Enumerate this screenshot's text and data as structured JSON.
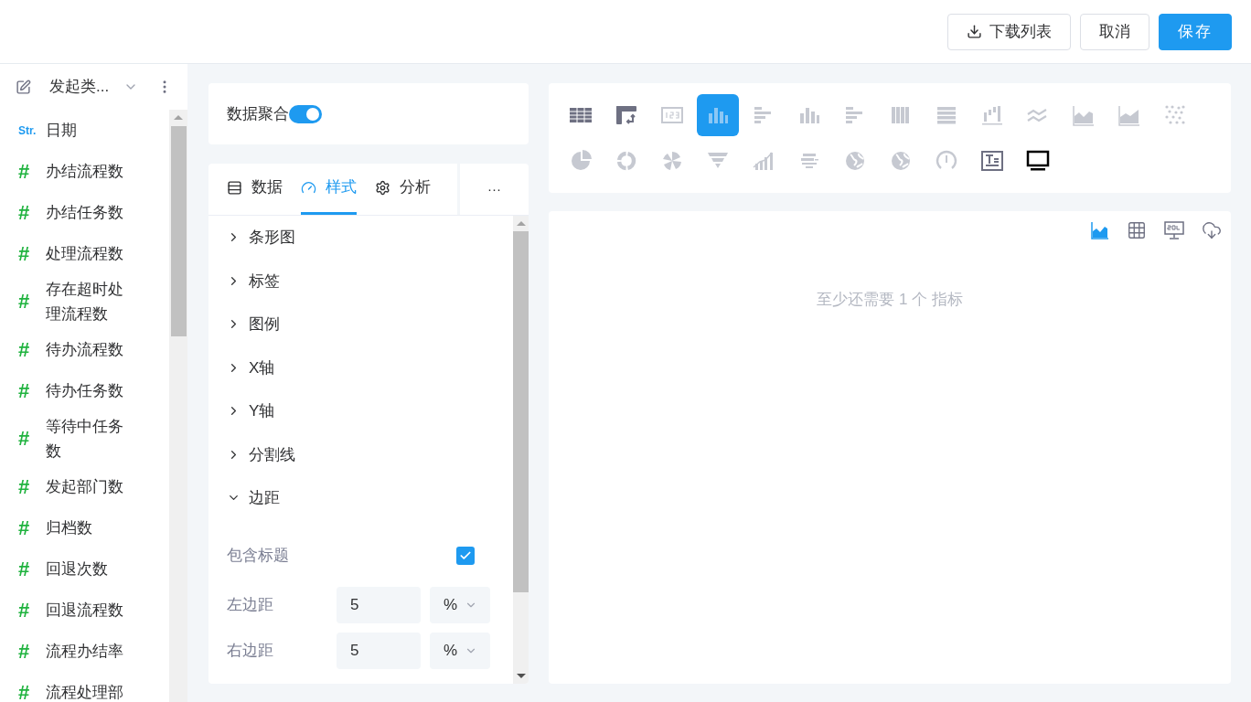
{
  "toolbar": {
    "buttons": [
      {
        "label": "下载列表",
        "kind": "download"
      },
      {
        "label": "取消",
        "kind": "default"
      },
      {
        "label": "保存",
        "kind": "primary"
      }
    ]
  },
  "sidebar": {
    "title": "发起类...",
    "items": [
      {
        "kind": "string",
        "type_label": "Str.",
        "label": "日期"
      },
      {
        "kind": "number",
        "type_label": "#",
        "label": "办结流程数"
      },
      {
        "kind": "number",
        "type_label": "#",
        "label": "办结任务数"
      },
      {
        "kind": "number",
        "type_label": "#",
        "label": "处理流程数"
      },
      {
        "kind": "number",
        "type_label": "#",
        "label": "存在超时处理流程数"
      },
      {
        "kind": "number",
        "type_label": "#",
        "label": "待办流程数"
      },
      {
        "kind": "number",
        "type_label": "#",
        "label": "待办任务数"
      },
      {
        "kind": "number",
        "type_label": "#",
        "label": "等待中任务数"
      },
      {
        "kind": "number",
        "type_label": "#",
        "label": "发起部门数"
      },
      {
        "kind": "number",
        "type_label": "#",
        "label": "归档数"
      },
      {
        "kind": "number",
        "type_label": "#",
        "label": "回退次数"
      },
      {
        "kind": "number",
        "type_label": "#",
        "label": "回退流程数"
      },
      {
        "kind": "number",
        "type_label": "#",
        "label": "流程办结率"
      },
      {
        "kind": "number",
        "type_label": "#",
        "label": "流程处理部"
      }
    ]
  },
  "aggregation": {
    "label": "数据聚合",
    "on": true
  },
  "tabs": [
    {
      "label": "数据",
      "kind": "data",
      "selected": false
    },
    {
      "label": "样式",
      "kind": "style",
      "selected": true
    },
    {
      "label": "分析",
      "kind": "analysis",
      "selected": false
    }
  ],
  "more": "···",
  "sections": [
    {
      "label": "条形图",
      "expanded": false
    },
    {
      "label": "标签",
      "expanded": false
    },
    {
      "label": "图例",
      "expanded": false
    },
    {
      "label": "X轴",
      "expanded": false
    },
    {
      "label": "Y轴",
      "expanded": false
    },
    {
      "label": "分割线",
      "expanded": false
    },
    {
      "label": "边距",
      "expanded": true
    }
  ],
  "margin": {
    "include_title": {
      "label": "包含标题",
      "checked": true
    },
    "rows": [
      {
        "label": "左边距",
        "value": "5",
        "unit": "%"
      },
      {
        "label": "右边距",
        "value": "5",
        "unit": "%"
      }
    ]
  },
  "chart_types": [
    {
      "kind": "table",
      "selected": false,
      "disabled": false
    },
    {
      "kind": "pivot",
      "selected": false,
      "disabled": false
    },
    {
      "kind": "number",
      "selected": false,
      "disabled": true
    },
    {
      "kind": "column",
      "selected": true,
      "disabled": false
    },
    {
      "kind": "bar",
      "selected": false,
      "disabled": true
    },
    {
      "kind": "column",
      "selected": false,
      "disabled": true
    },
    {
      "kind": "bar",
      "selected": false,
      "disabled": true
    },
    {
      "kind": "stackcol",
      "selected": false,
      "disabled": true
    },
    {
      "kind": "stackbar",
      "selected": false,
      "disabled": true
    },
    {
      "kind": "waterfall",
      "selected": false,
      "disabled": true
    },
    {
      "kind": "wave",
      "selected": false,
      "disabled": true
    },
    {
      "kind": "area",
      "selected": false,
      "disabled": true
    },
    {
      "kind": "area2",
      "selected": false,
      "disabled": true
    },
    {
      "kind": "scatter",
      "selected": false,
      "disabled": true
    },
    {
      "kind": "pie",
      "selected": false,
      "disabled": true
    },
    {
      "kind": "donut",
      "selected": false,
      "disabled": true
    },
    {
      "kind": "rose",
      "selected": false,
      "disabled": true
    },
    {
      "kind": "funnel",
      "selected": false,
      "disabled": true
    },
    {
      "kind": "combo",
      "selected": false,
      "disabled": true
    },
    {
      "kind": "wordcloud",
      "selected": false,
      "disabled": true
    },
    {
      "kind": "globe",
      "selected": false,
      "disabled": true
    },
    {
      "kind": "globe",
      "selected": false,
      "disabled": true
    },
    {
      "kind": "gauge",
      "selected": false,
      "disabled": true
    },
    {
      "kind": "text",
      "selected": false,
      "disabled": false
    },
    {
      "kind": "screen",
      "selected": false,
      "disabled": false
    }
  ],
  "view_tools": [
    {
      "kind": "chart",
      "selected": true
    },
    {
      "kind": "table",
      "selected": false
    },
    {
      "kind": "sql",
      "selected": false
    },
    {
      "kind": "download",
      "selected": false
    }
  ],
  "empty_message": "至少还需要 1 个 指标"
}
